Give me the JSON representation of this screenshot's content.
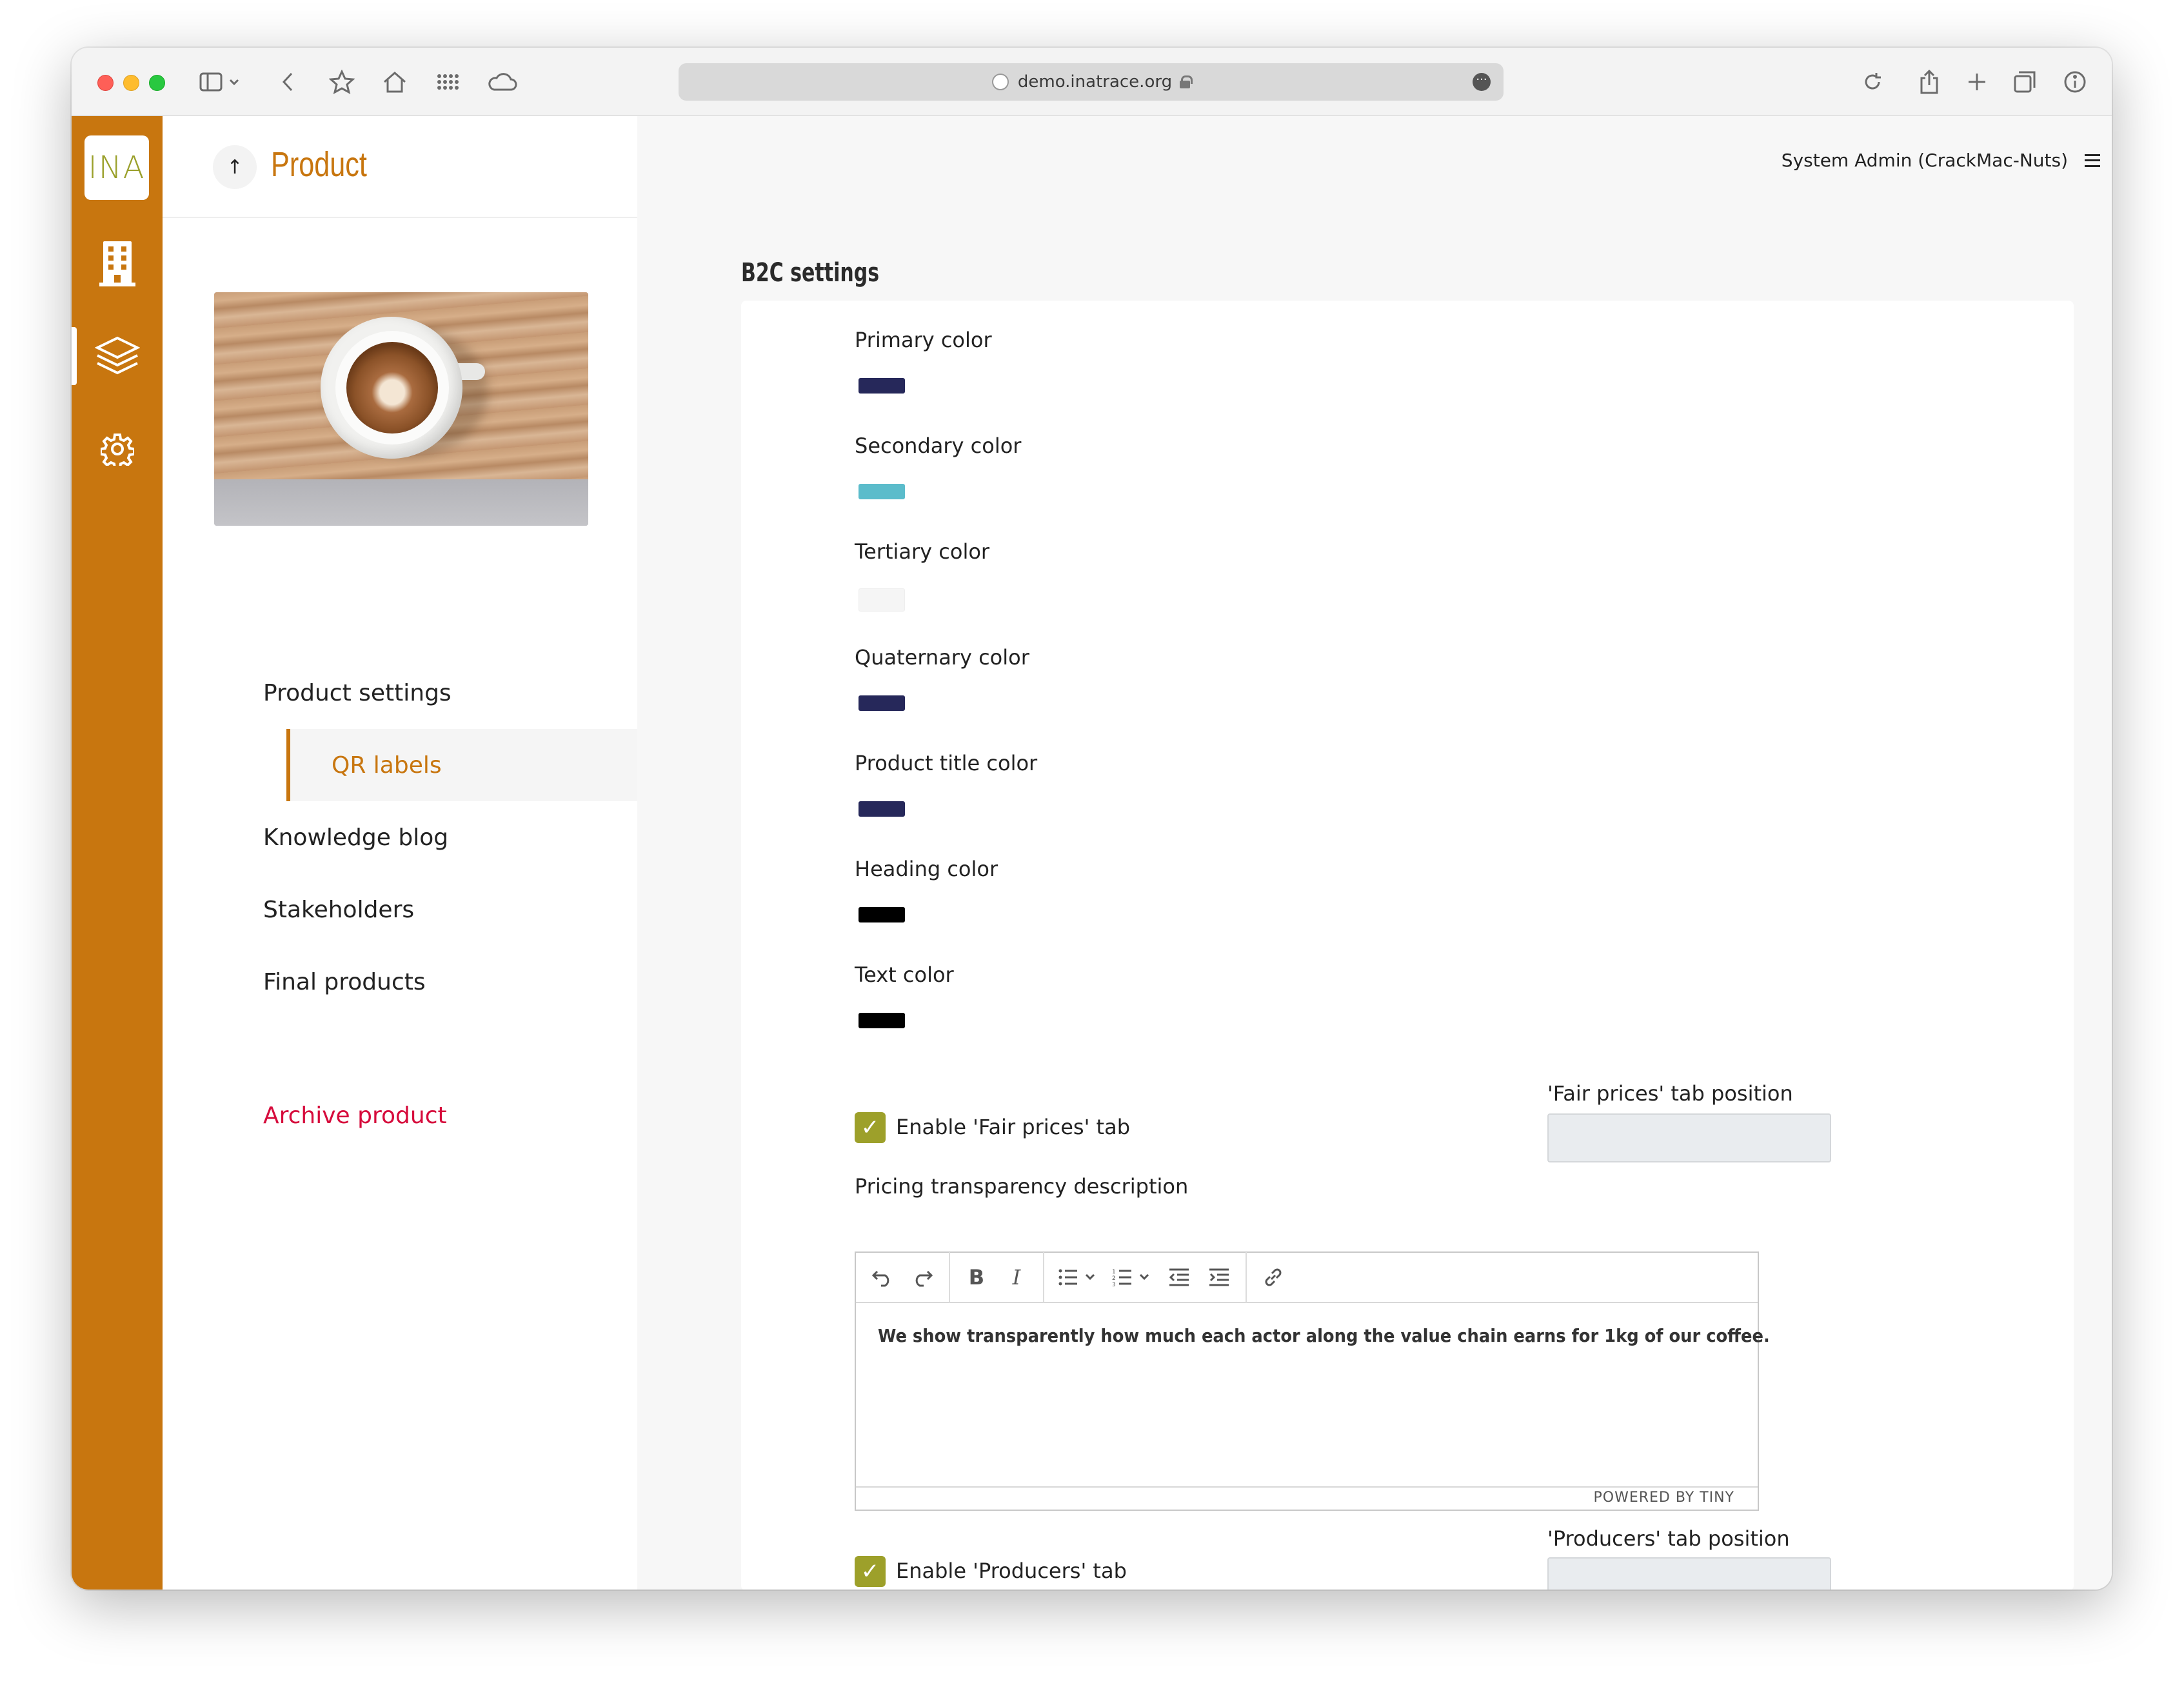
{
  "browser": {
    "url": "demo.inatrace.org"
  },
  "app": {
    "logo_text": "INA",
    "rail": [
      {
        "icon": "building-icon"
      },
      {
        "icon": "layers-icon",
        "active": true
      },
      {
        "icon": "gear-icon"
      }
    ]
  },
  "side": {
    "title": "Product",
    "back_icon": "↑",
    "nav": [
      {
        "label": "Product settings"
      },
      {
        "label": "QR labels",
        "active": true
      },
      {
        "label": "Knowledge blog"
      },
      {
        "label": "Stakeholders"
      },
      {
        "label": "Final products"
      }
    ],
    "archive": "Archive product"
  },
  "header": {
    "user": "System Admin (CrackMac-Nuts)"
  },
  "b2c": {
    "title": "B2C settings",
    "colors": [
      {
        "label": "Primary color",
        "value": "#26285a"
      },
      {
        "label": "Secondary color",
        "value": "#5bbccb"
      },
      {
        "label": "Tertiary color",
        "value": "#f5f5f5"
      },
      {
        "label": "Quaternary color",
        "value": "#26285a"
      },
      {
        "label": "Product title color",
        "value": "#26285a"
      },
      {
        "label": "Heading color",
        "value": "#000000"
      },
      {
        "label": "Text color",
        "value": "#000000"
      }
    ],
    "fair_prices": {
      "checkbox_label": "Enable 'Fair prices' tab",
      "checked": true,
      "position_label": "'Fair prices' tab position",
      "position_value": ""
    },
    "pricing": {
      "label": "Pricing transparency description",
      "content": "We show transparently how much each actor along the value chain earns for 1kg of our coffee.",
      "status": "POWERED BY TINY"
    },
    "producers": {
      "checkbox_label": "Enable 'Producers' tab",
      "checked": true,
      "position_label": "'Producers' tab position",
      "position_value": ""
    }
  }
}
